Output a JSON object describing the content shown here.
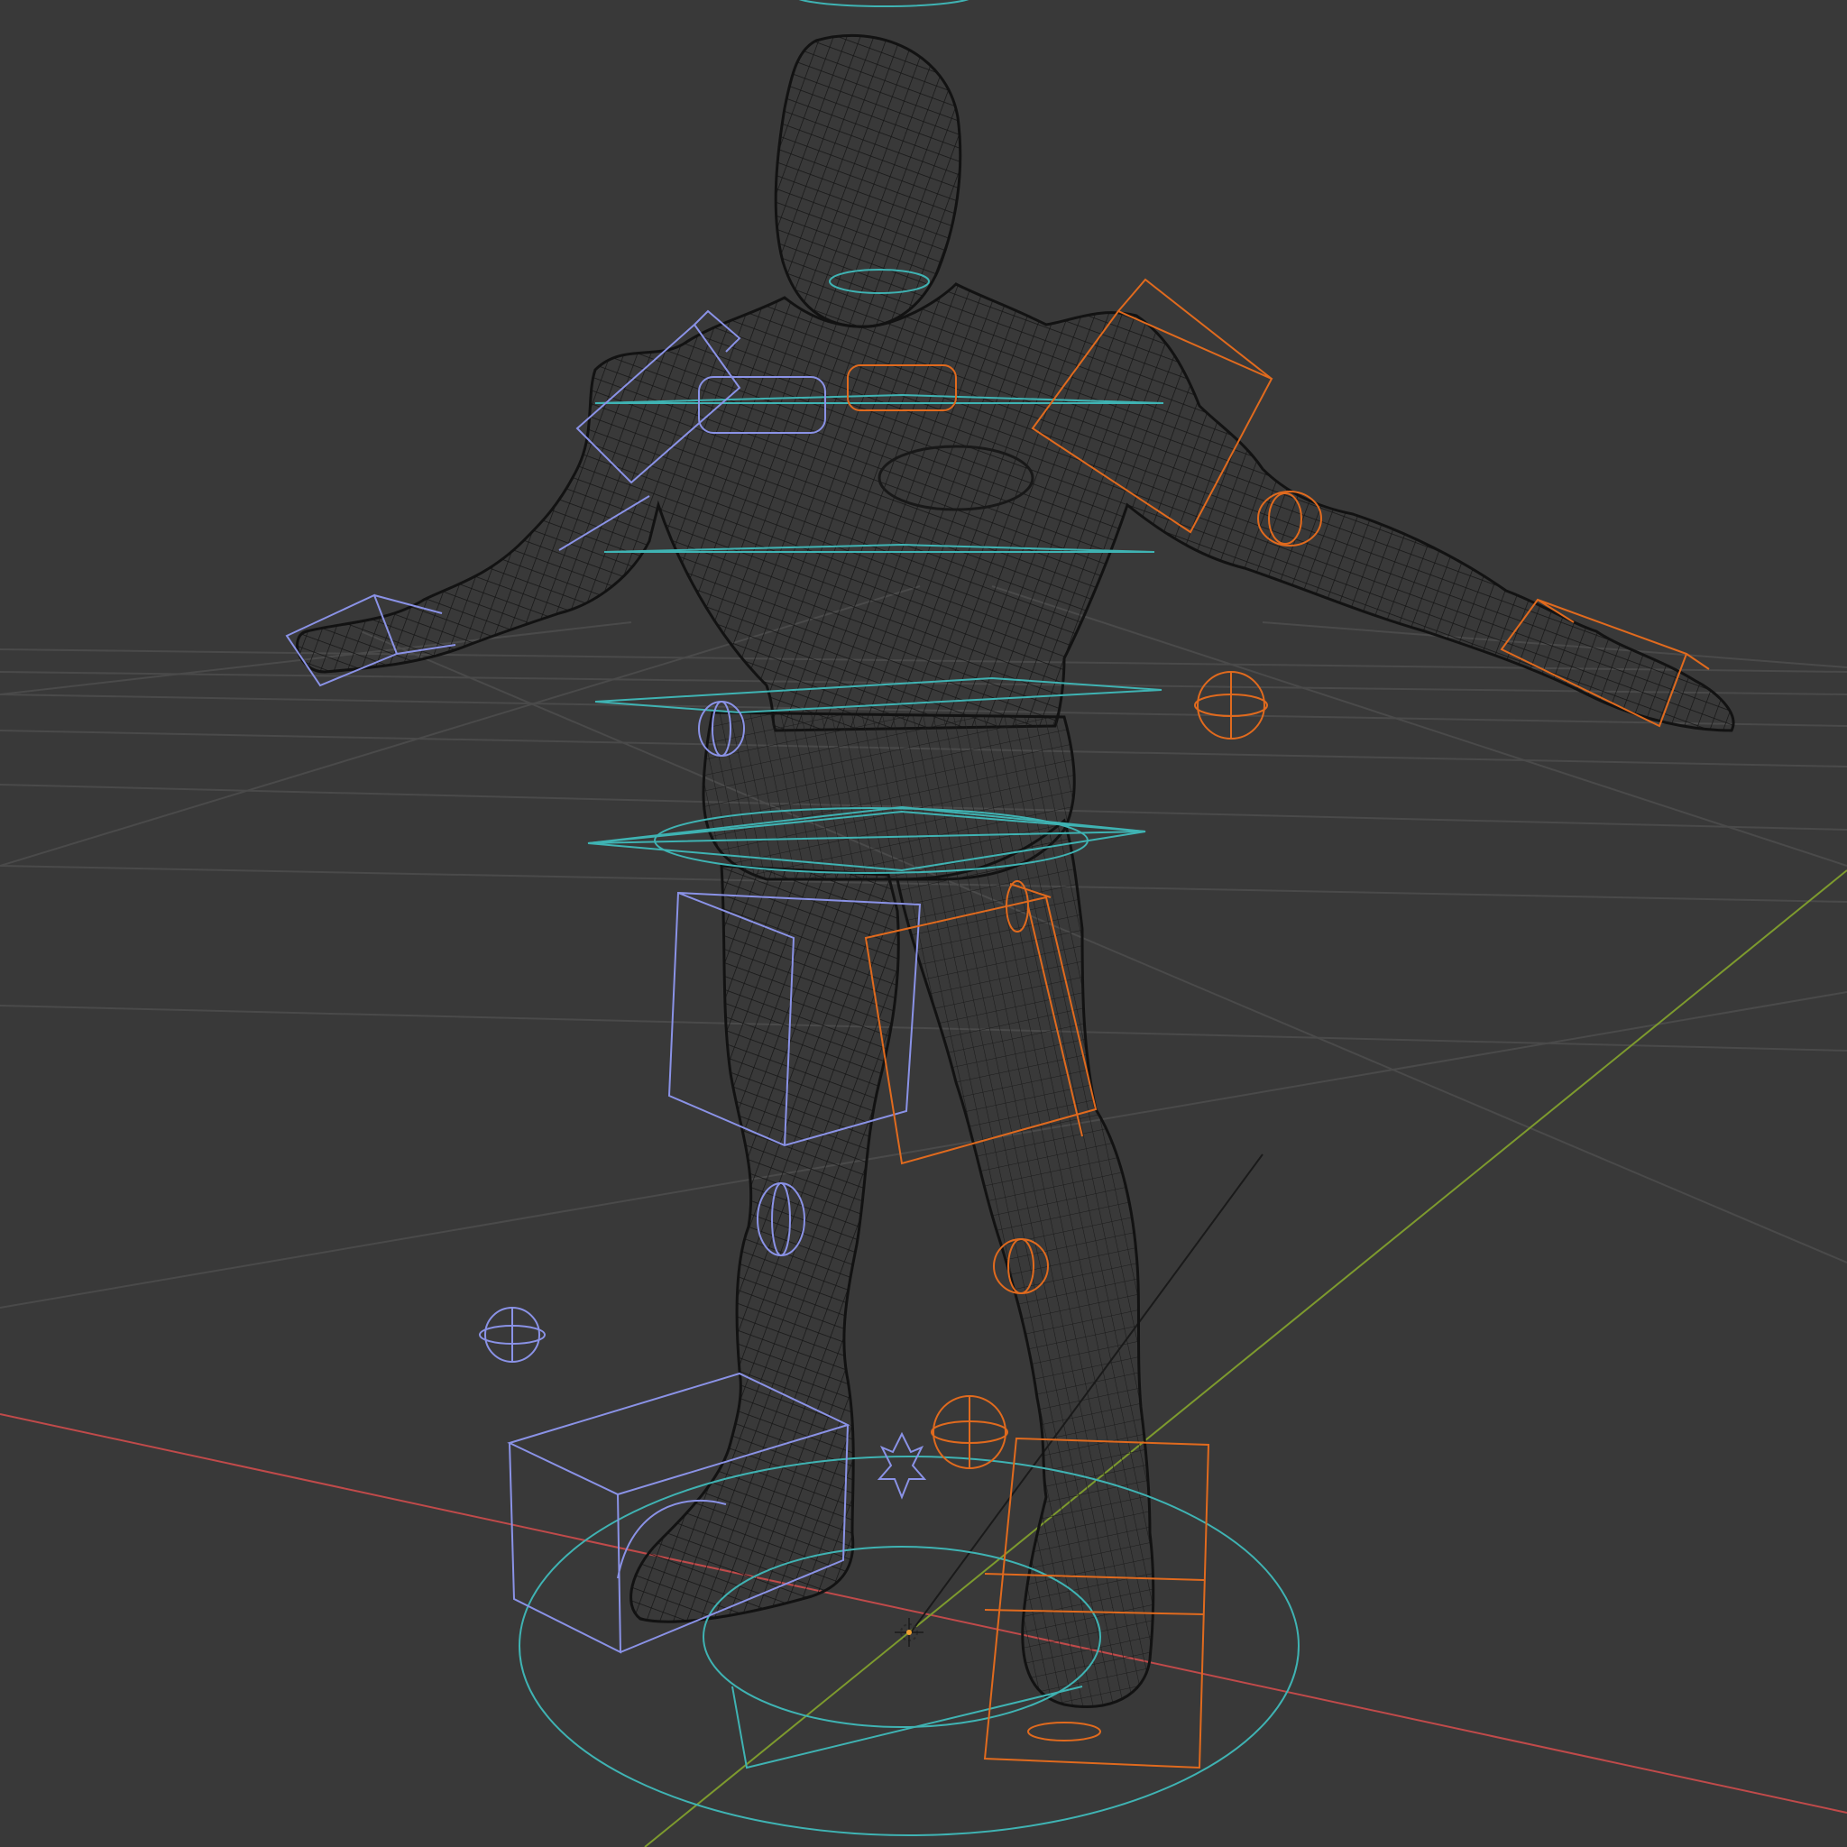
{
  "viewport": {
    "background": "#393939",
    "grid_color": "#4a4a4a",
    "axis_x_color": "#c04a4a",
    "axis_y_color": "#7d9a2e",
    "mesh_color": "#111111",
    "left_controls_color": "#8a92e6",
    "right_controls_color": "#e06a1e",
    "center_controls_color": "#3fb3b3"
  },
  "objects": {
    "mesh": "character-wireframe-mesh",
    "armature": "rig-controls",
    "origin": "3d-cursor-icon"
  }
}
